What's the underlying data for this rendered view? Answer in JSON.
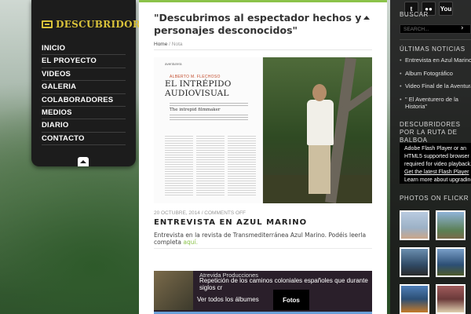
{
  "site": {
    "logo_text": "DESCUBRIDORES",
    "logo_icon": "camera-icon"
  },
  "nav": {
    "items": [
      "INICIO",
      "EL PROYECTO",
      "VIDEOS",
      "GALERIA",
      "COLABORADORES",
      "MEDIOS",
      "DIARIO",
      "CONTACTO"
    ],
    "collapse_icon": "chevron-up-icon"
  },
  "post": {
    "title": "\"Descubrimos al espectador hechos y personajes desconocidos\"",
    "breadcrumb_home": "Home",
    "breadcrumb_sep": "/",
    "breadcrumb_current": "Nota",
    "magazine": {
      "brand": "aventurera",
      "author": "ALBERTO M. FLECHOSO",
      "headline": "EL INTRÉPIDO AUDIOVISUAL",
      "subheadline": "The intrepid filmmaker"
    }
  },
  "post2": {
    "meta": "20 OCTUBRE, 2014 / COMMENTS OFF",
    "title": "ENTREVISTA EN AZUL MARINO",
    "excerpt": "Entrevista en la revista de Transmediterránea Azul Marino. Podéis leerla completa",
    "link_text": "aquí."
  },
  "album": {
    "producer": "Atrevida Producciones",
    "description": "Repetición de los caminos coloniales españoles que durante siglos cr",
    "all_albums": "Ver todos los álbumes",
    "tab": "Fotos"
  },
  "sidebar": {
    "search_heading": "BUSCAR",
    "search_placeholder": "SEARCH...",
    "search_go": "›",
    "social": [
      {
        "icon": "twitter-icon",
        "label": "t"
      },
      {
        "icon": "flickr-icon",
        "label": "●●"
      },
      {
        "icon": "youtube-icon",
        "label": "You"
      }
    ],
    "news_heading": "ÚLTIMAS NOTICIAS",
    "news": [
      "Entrevista en Azul Marino",
      "Album Fotográfico",
      "Video Final de la Aventura",
      "\" El Aventurero de la",
      "Historia\""
    ],
    "route_heading": "DESCUBRIDORES POR LA RUTA DE BALBOA",
    "flash_lines": [
      "Adobe Flash Player or an",
      "HTML5 supported browser is",
      "required for video playback."
    ],
    "flash_link": "Get the latest Flash Player",
    "flash_more": "Learn more about upgrading",
    "flickr_heading": "PHOTOS ON FLICKR"
  }
}
